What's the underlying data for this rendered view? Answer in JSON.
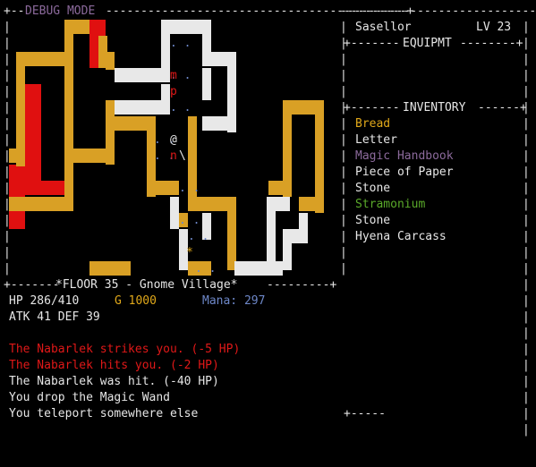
{
  "header": {
    "debug_mode": "DEBUG MODE"
  },
  "player": {
    "name": "Sasellor",
    "level": "LV 23"
  },
  "panels": {
    "equipment": "EQUIPMT",
    "inventory": "INVENTORY"
  },
  "inventory": [
    {
      "name": "Bread",
      "color": "#e0a81a"
    },
    {
      "name": "Letter",
      "color": "#e6e6e6"
    },
    {
      "name": "Magic Handbook",
      "color": "#8c6a9c"
    },
    {
      "name": "Piece of Paper",
      "color": "#e6e6e6"
    },
    {
      "name": "Stone",
      "color": "#e6e6e6"
    },
    {
      "name": "Stramonium",
      "color": "#5aaa2a"
    },
    {
      "name": "Stone",
      "color": "#e6e6e6"
    },
    {
      "name": "Hyena Carcass",
      "color": "#e6e6e6"
    }
  ],
  "floor_label": "*FLOOR 35 - Gnome Village*",
  "stats": {
    "hp": "HP 286/410",
    "gold": "G 1000",
    "mana": "Mana: 297",
    "atk_def": "ATK 41 DEF 39"
  },
  "messages": [
    {
      "text": "The Nabarlek strikes you. (-5 HP)",
      "color": "#e01818"
    },
    {
      "text": "The Nabarlek hits you. (-2 HP)",
      "color": "#e01818"
    },
    {
      "text": "The Nabarlek was hit. (-40 HP)",
      "color": "#e6e6e6"
    },
    {
      "text": "You drop the Magic Wand",
      "color": "#e6e6e6"
    },
    {
      "text": "You teleport somewhere else",
      "color": "#e6e6e6"
    }
  ],
  "map": {
    "player_glyph": "@",
    "monster_glyphs": [
      "m",
      "p",
      "n"
    ],
    "item_glyphs": [
      "\\",
      "*"
    ]
  }
}
